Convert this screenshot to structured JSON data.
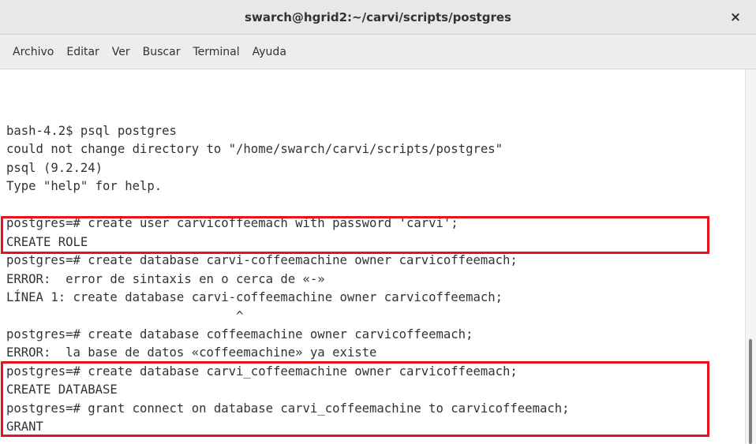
{
  "window": {
    "title": "swarch@hgrid2:~/carvi/scripts/postgres",
    "close_glyph": "×"
  },
  "menu": [
    "Archivo",
    "Editar",
    "Ver",
    "Buscar",
    "Terminal",
    "Ayuda"
  ],
  "terminal": {
    "lines": [
      "bash-4.2$ psql postgres",
      "could not change directory to \"/home/swarch/carvi/scripts/postgres\"",
      "psql (9.2.24)",
      "Type \"help\" for help.",
      "",
      "postgres=# create user carvicoffeemach with password 'carvi';",
      "CREATE ROLE",
      "postgres=# create database carvi-coffeemachine owner carvicoffeemach;",
      "ERROR:  error de sintaxis en o cerca de «-»",
      "LÍNEA 1: create database carvi-coffeemachine owner carvicoffeemach;",
      "                               ^",
      "",
      "postgres=# create database coffeemachine owner carvicoffeemach;",
      "ERROR:  la base de datos «coffeemachine» ya existe",
      "postgres=# create database carvi_coffeemachine owner carvicoffeemach;",
      "CREATE DATABASE",
      "postgres=# grant connect on database carvi_coffeemachine to carvicoffeemach;",
      "GRANT"
    ]
  },
  "colors": {
    "highlight": "#e8121f",
    "text": "#2e3436",
    "background": "#ffffff"
  },
  "icons": {
    "close": "close-icon"
  }
}
